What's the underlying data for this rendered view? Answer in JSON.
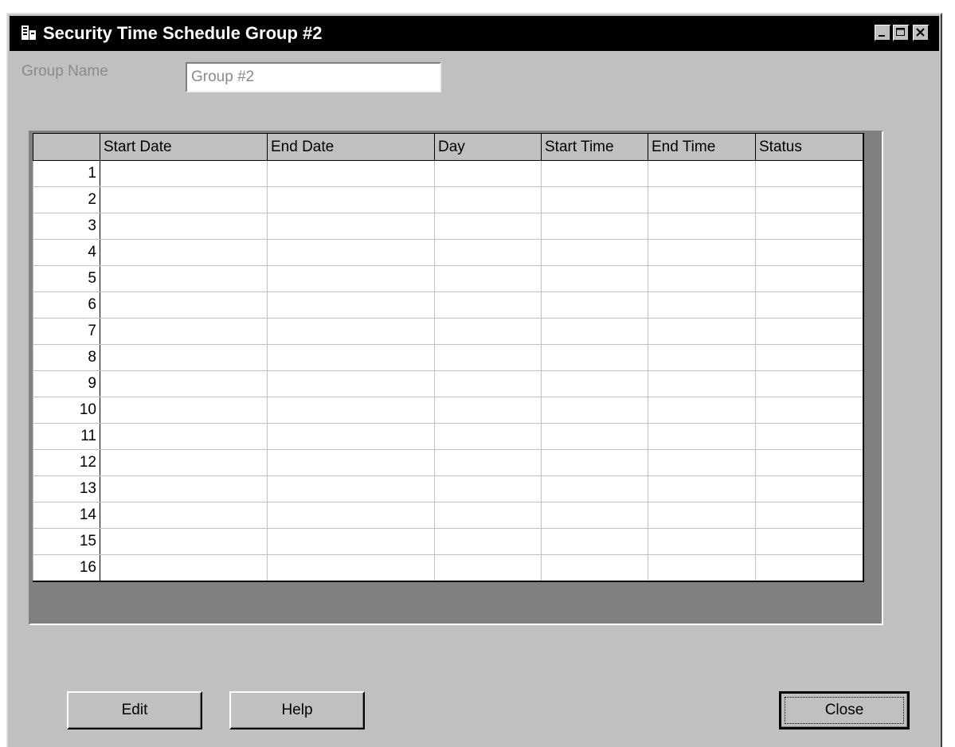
{
  "window": {
    "title": "Security Time Schedule Group #2",
    "controls": [
      "minimize-icon",
      "maximize-icon",
      "close-icon"
    ]
  },
  "form": {
    "group_name_label": "Group Name",
    "group_name_value": "Group #2"
  },
  "grid": {
    "columns": [
      "Start Date",
      "End Date",
      "Day",
      "Start Time",
      "End Time",
      "Status"
    ],
    "rows": [
      "1",
      "2",
      "3",
      "4",
      "5",
      "6",
      "7",
      "8",
      "9",
      "10",
      "11",
      "12",
      "13",
      "14",
      "15",
      "16"
    ]
  },
  "buttons": {
    "edit": "Edit",
    "help": "Help",
    "close": "Close"
  },
  "colors": {
    "window_bg": "#c0c0c0",
    "titlebar_bg": "#000000",
    "disabled_text": "#8a8a8a",
    "grid_bg": "#808080"
  }
}
